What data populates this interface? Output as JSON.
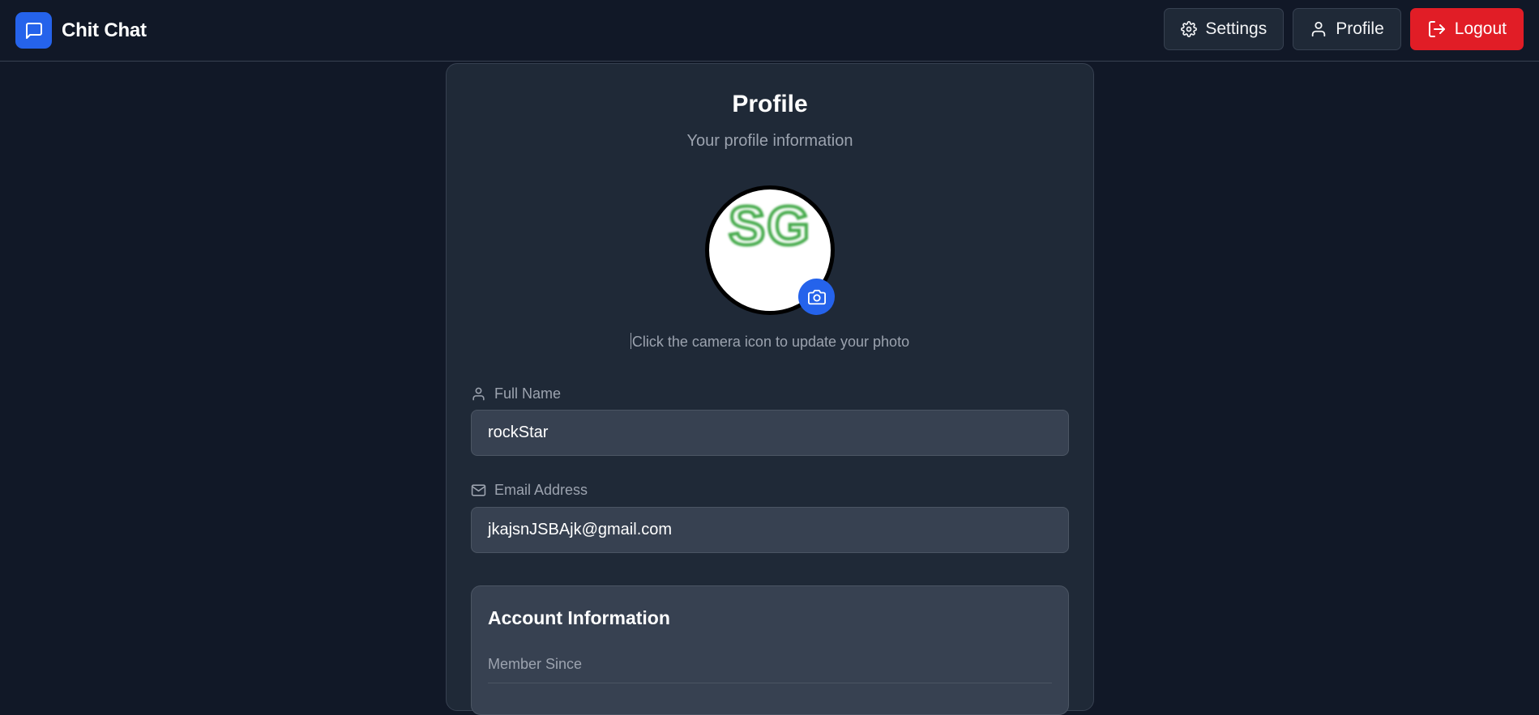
{
  "app": {
    "name": "Chit Chat",
    "logo_icon": "chat-bubble-icon"
  },
  "nav": {
    "settings_label": "Settings",
    "profile_label": "Profile",
    "logout_label": "Logout"
  },
  "profile": {
    "title": "Profile",
    "subtitle": "Your profile information",
    "avatar_initials": "SG",
    "photo_hint": "Click the camera icon to update your photo",
    "fields": {
      "full_name": {
        "label": "Full Name",
        "value": "rockStar",
        "icon": "user-icon"
      },
      "email": {
        "label": "Email Address",
        "value": "jkajsnJSBAjk@gmail.com",
        "icon": "mail-icon"
      }
    },
    "account": {
      "title": "Account Information",
      "member_since_label": "Member Since"
    }
  },
  "colors": {
    "background": "#111827",
    "card": "#1f2937",
    "accent": "#2563eb",
    "danger": "#e11d26"
  }
}
